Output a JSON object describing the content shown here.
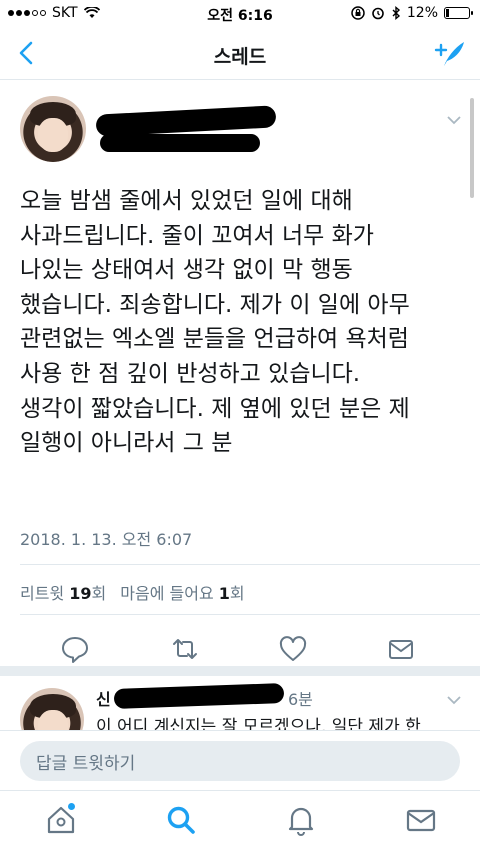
{
  "status_bar": {
    "carrier": "SKT",
    "time": "오전 6:16",
    "battery": "12%",
    "battery_level": 0.12
  },
  "nav": {
    "title": "스레드"
  },
  "tweet": {
    "text": "오늘 밤샘 줄에서 있었던 일에 대해\n사과드립니다. 줄이 꼬여서 너무 화가\n나있는 상태여서 생각 없이 막 행동\n했습니다. 죄송합니다. 제가 이 일에 아무\n관련없는 엑소엘 분들을 언급하여 욕처럼\n사용 한 점 깊이 반성하고 있습니다.\n생각이 짧았습니다. 제 옆에 있던 분은 제\n일행이 아니라서 그 분",
    "timestamp": "2018. 1. 13. 오전 6:07",
    "retweets_label": "리트윗",
    "retweets_count": "19",
    "retweets_unit": "회",
    "likes_label": "마음에 들어요",
    "likes_count": "1",
    "likes_unit": "회"
  },
  "reply": {
    "name_visible": "신",
    "time_suffix": "6분",
    "text": "이 어디 계신지는 잘 모르겠으나, 일단 제가 한"
  },
  "composer": {
    "placeholder": "답글 트윗하기"
  },
  "colors": {
    "accent": "#1da1f2",
    "secondary_text": "#657786",
    "divider": "#e1e8ed"
  },
  "tabs": [
    "home-icon",
    "search-icon",
    "notifications-icon",
    "messages-icon"
  ]
}
